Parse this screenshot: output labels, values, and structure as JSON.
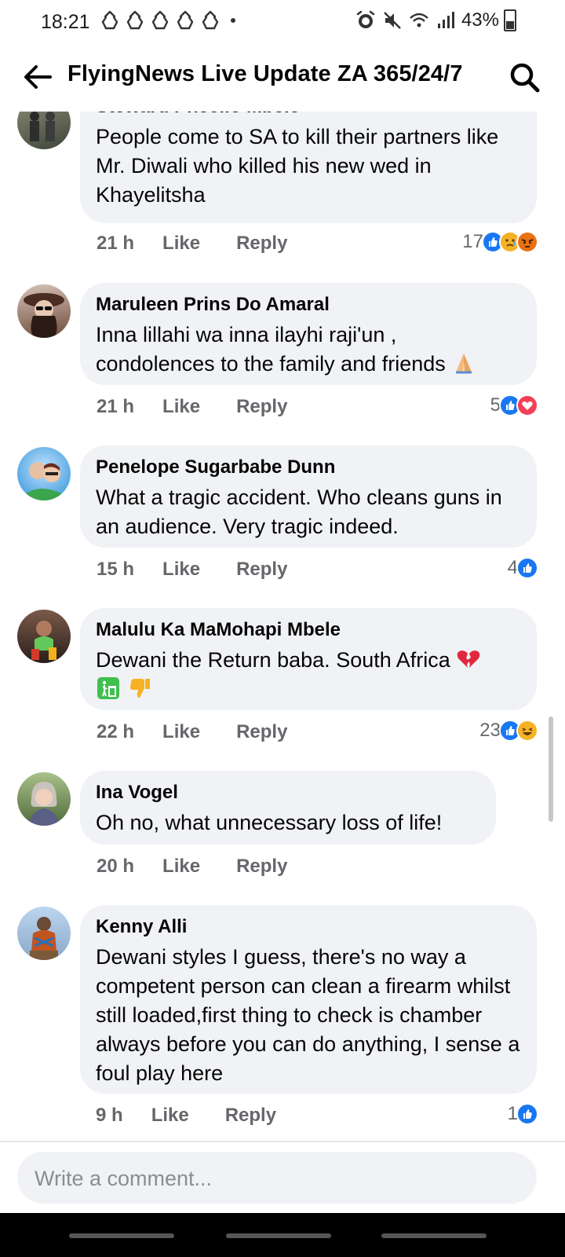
{
  "status_bar": {
    "time": "18:21",
    "battery": "43%",
    "notification_icons": [
      "recycle-icon",
      "recycle-icon",
      "recycle-icon",
      "recycle-icon",
      "recycle-icon"
    ],
    "system_icons": [
      "alarm-icon",
      "mute-icon",
      "wifi-icon",
      "signal-icon",
      "battery-icon"
    ]
  },
  "header": {
    "title": "FlyingNews Live Update ZA 365/24/7"
  },
  "comments": [
    {
      "author": "Steward Pheello Mbele",
      "text": "People come to SA to kill their partners like Mr. Diwali who killed his new wed in Khayelitsha",
      "time": "21 h",
      "like_label": "Like",
      "reply_label": "Reply",
      "reaction_count": "17",
      "reactions": [
        "like-icon",
        "sad-icon",
        "angry-icon"
      ]
    },
    {
      "author": "Maruleen Prins Do Amaral",
      "text": "Inna lillahi wa inna ilayhi raji'un , condolences to the family and friends",
      "emoji": "folded-hands-icon",
      "time": "21 h",
      "like_label": "Like",
      "reply_label": "Reply",
      "reaction_count": "5",
      "reactions": [
        "like-icon",
        "love-icon"
      ]
    },
    {
      "author": "Penelope Sugarbabe Dunn",
      "text": "What a tragic accident. Who cleans guns in an audience. Very tragic indeed.",
      "time": "15 h",
      "like_label": "Like",
      "reply_label": "Reply",
      "reaction_count": "4",
      "reactions": [
        "like-icon"
      ]
    },
    {
      "author": "Malulu Ka MaMohapi Mbele",
      "text": "Dewani the Return baba. South Africa",
      "emoji": [
        "broken-heart-icon",
        "litter-bin-icon",
        "thumbs-down-icon"
      ],
      "time": "22 h",
      "like_label": "Like",
      "reply_label": "Reply",
      "reaction_count": "23",
      "reactions": [
        "like-icon",
        "haha-icon"
      ]
    },
    {
      "author": "Ina Vogel",
      "text": "Oh no, what unnecessary loss of life!",
      "time": "20 h",
      "like_label": "Like",
      "reply_label": "Reply"
    },
    {
      "author": "Kenny Alli",
      "text": "Dewani styles I guess, there's no way a competent person can clean a firearm whilst still loaded,first thing to check is chamber always before you can do anything, I sense a foul play here",
      "time": "9 h",
      "like_label": "Like",
      "reply_label": "Reply",
      "reaction_count": "1",
      "reactions": [
        "like-icon"
      ]
    }
  ],
  "composer": {
    "placeholder": "Write a comment..."
  },
  "colors": {
    "bubble": "#f0f2f5",
    "meta_text": "#65676b",
    "like_blue": "#1877f2",
    "love_red": "#f33e58",
    "angry_orange": "#e9710f",
    "emoji_yellow": "#f7b125"
  }
}
